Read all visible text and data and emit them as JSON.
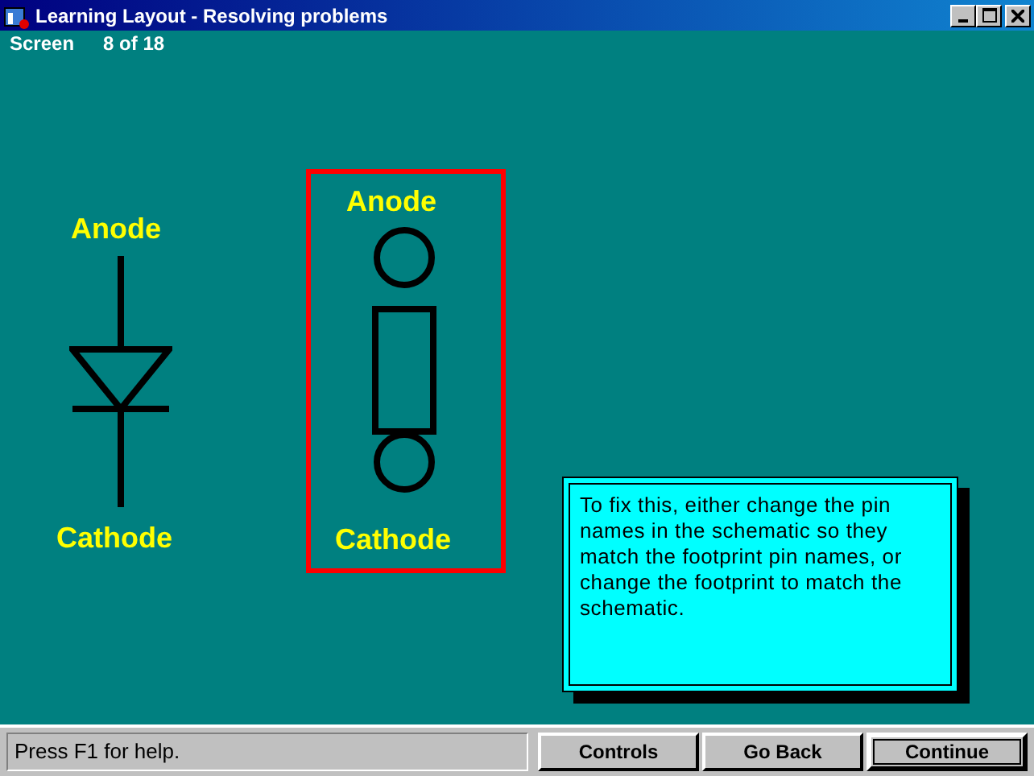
{
  "window": {
    "title": "Learning Layout - Resolving problems"
  },
  "screen_counter": {
    "label": "Screen",
    "value": "8 of 18"
  },
  "schematic": {
    "top_label": "Anode",
    "bottom_label": "Cathode"
  },
  "footprint": {
    "top_label": "Anode",
    "bottom_label": "Cathode",
    "highlighted": true
  },
  "note": "To fix this, either change the pin names in the schematic so they match the footprint pin names, or change the footprint to match the schematic.",
  "status_bar": {
    "text": "Press F1 for help."
  },
  "buttons": [
    {
      "label": "Controls",
      "default": false
    },
    {
      "label": "Go Back",
      "default": false
    },
    {
      "label": "Continue",
      "default": true
    }
  ]
}
